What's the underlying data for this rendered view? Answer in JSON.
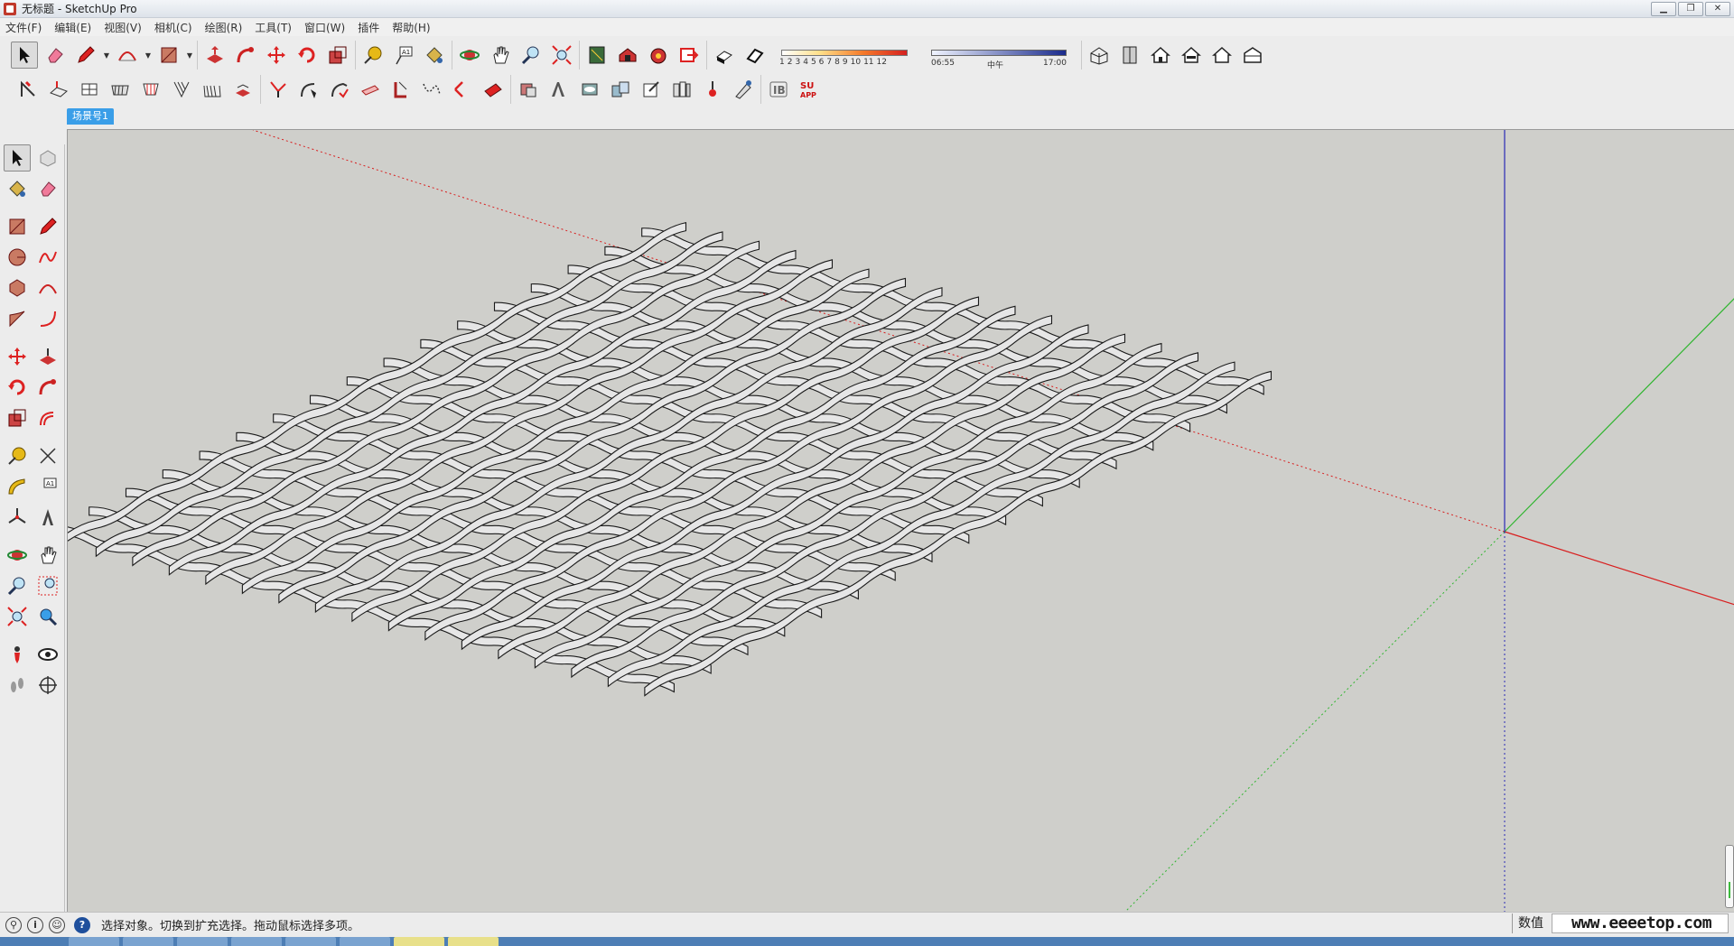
{
  "window": {
    "title": "无标题 - SketchUp Pro",
    "minimize": "▁",
    "restore": "❐",
    "close": "✕"
  },
  "menu": [
    "文件(F)",
    "编辑(E)",
    "视图(V)",
    "相机(C)",
    "绘图(R)",
    "工具(T)",
    "窗口(W)",
    "插件",
    "帮助(H)"
  ],
  "shadow_scale": {
    "numbers": [
      "1",
      "2",
      "3",
      "4",
      "5",
      "6",
      "7",
      "8",
      "9",
      "10",
      "11",
      "12"
    ]
  },
  "time_scale": {
    "start": "06:55",
    "mid": "中午",
    "end": "17:00"
  },
  "scene_tab": "场景号1",
  "status": {
    "message": "选择对象。切换到扩充选择。拖动鼠标选择多项。",
    "measure_label": "数值",
    "watermark": "www.eeeetop.com"
  },
  "colors": {
    "viewport_bg": "#cfcfcb",
    "axis_red": "#d81e1e",
    "axis_green": "#2fb52f",
    "axis_blue": "#2a2ab5",
    "strip": "#e6e6e6",
    "scene_tab": "#3a9ee8"
  },
  "icons": {
    "toolbar_top": [
      "select-icon",
      "eraser-icon",
      "pencil-icon",
      "arc-icon",
      "rectangle-icon",
      "push-pull-icon",
      "follow-me-icon",
      "move-icon",
      "rotate-icon",
      "scale-icon",
      "tape-measure-icon",
      "text-icon",
      "paint-bucket-icon",
      "orbit-icon",
      "pan-icon",
      "zoom-icon",
      "zoom-extents-icon",
      "components-icon",
      "warehouse-icon",
      "extension-warehouse-icon",
      "send-to-layout-icon",
      "shadows-icon",
      "fog-icon",
      "iso-view-icon",
      "top-view-icon",
      "front-view-icon",
      "right-view-icon",
      "back-view-icon",
      "left-view-icon"
    ],
    "toolbar_second": [
      "sandbox-icon",
      "from-contours-icon",
      "smoove-icon",
      "stamp-icon",
      "drape-icon",
      "add-detail-icon",
      "flip-edge-icon",
      "solid-tools-icon",
      "intersect-icon",
      "union-icon",
      "subtract-icon",
      "trim-icon",
      "split-icon",
      "offset-icon",
      "section-plane-icon",
      "style-icon",
      "layers-icon",
      "outliner-icon",
      "materials-icon",
      "entity-info-icon",
      "plugin-b-icon",
      "su-app-icon"
    ]
  }
}
